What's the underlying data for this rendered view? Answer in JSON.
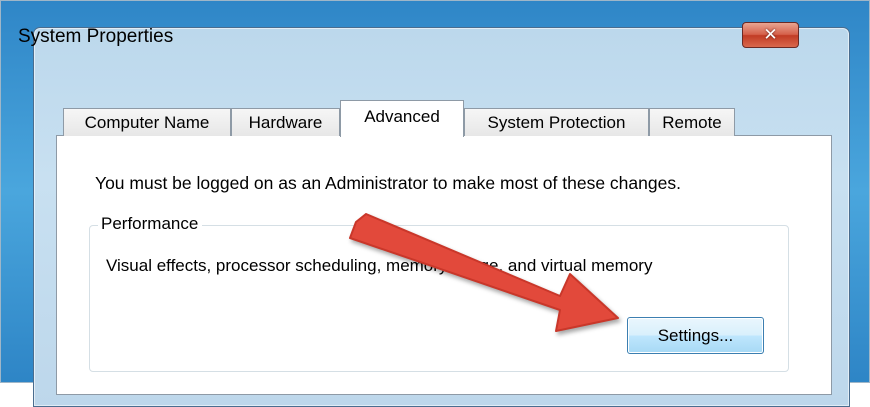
{
  "window": {
    "title": "System Properties",
    "close_symbol": "✕"
  },
  "tabs": [
    {
      "label": "Computer Name",
      "active": false
    },
    {
      "label": "Hardware",
      "active": false
    },
    {
      "label": "Advanced",
      "active": true
    },
    {
      "label": "System Protection",
      "active": false
    },
    {
      "label": "Remote",
      "active": false
    }
  ],
  "content": {
    "notice": "You must be logged on as an Administrator to make most of these changes.",
    "performance": {
      "heading": "Performance",
      "description": "Visual effects, processor scheduling, memory usage, and virtual memory",
      "settings_label": "Settings..."
    }
  },
  "annotation": {
    "arrow_color": "#e2493b",
    "icon": "red-arrow-pointer"
  }
}
